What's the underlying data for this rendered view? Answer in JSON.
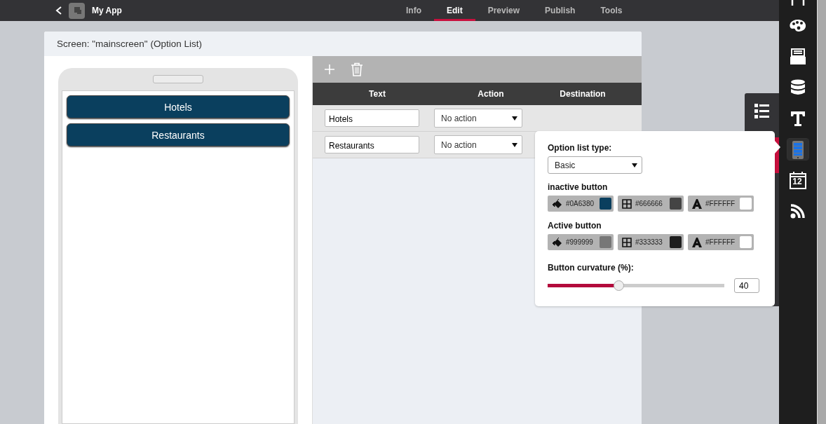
{
  "app": {
    "title": "My App"
  },
  "tabs": [
    {
      "label": "Info",
      "selected": false
    },
    {
      "label": "Edit",
      "selected": true
    },
    {
      "label": "Preview",
      "selected": false
    },
    {
      "label": "Publish",
      "selected": false
    },
    {
      "label": "Tools",
      "selected": false
    }
  ],
  "screen_title": "Screen: \"mainscreen\" (Option List)",
  "preview_buttons": [
    "Hotels",
    "Restaurants"
  ],
  "table": {
    "columns": [
      "Text",
      "Action",
      "Destination"
    ],
    "rows": [
      {
        "text": "Hotels",
        "action": "No action"
      },
      {
        "text": "Restaurants",
        "action": "No action"
      }
    ]
  },
  "sidebar": {
    "items": [
      {
        "kind": "frame",
        "selected": false
      },
      {
        "kind": "palette",
        "selected": false
      },
      {
        "kind": "tray",
        "selected": false
      },
      {
        "kind": "database",
        "selected": false
      },
      {
        "kind": "text",
        "selected": false
      },
      {
        "kind": "phone",
        "selected": true
      },
      {
        "kind": "calendar",
        "label": "12",
        "selected": false
      },
      {
        "kind": "feed",
        "selected": false
      }
    ]
  },
  "popover": {
    "type_label": "Option list type:",
    "type_value": "Basic",
    "groups": [
      {
        "label": "inactive button",
        "swatches": [
          {
            "kind": "fill",
            "value": "#0A6380",
            "color": "#0a3f5e"
          },
          {
            "kind": "border",
            "value": "#666666",
            "color": "#444444"
          },
          {
            "kind": "font",
            "value": "#FFFFFF",
            "color": "#ffffff"
          }
        ]
      },
      {
        "label": "Active button",
        "swatches": [
          {
            "kind": "fill",
            "value": "#999999",
            "color": "#777777"
          },
          {
            "kind": "border",
            "value": "#333333",
            "color": "#1e1e1e"
          },
          {
            "kind": "font",
            "value": "#FFFFFF",
            "color": "#ffffff"
          }
        ]
      }
    ],
    "curvature_label": "Button curvature (%):",
    "curvature": {
      "level": 0.4,
      "value": "40"
    }
  }
}
